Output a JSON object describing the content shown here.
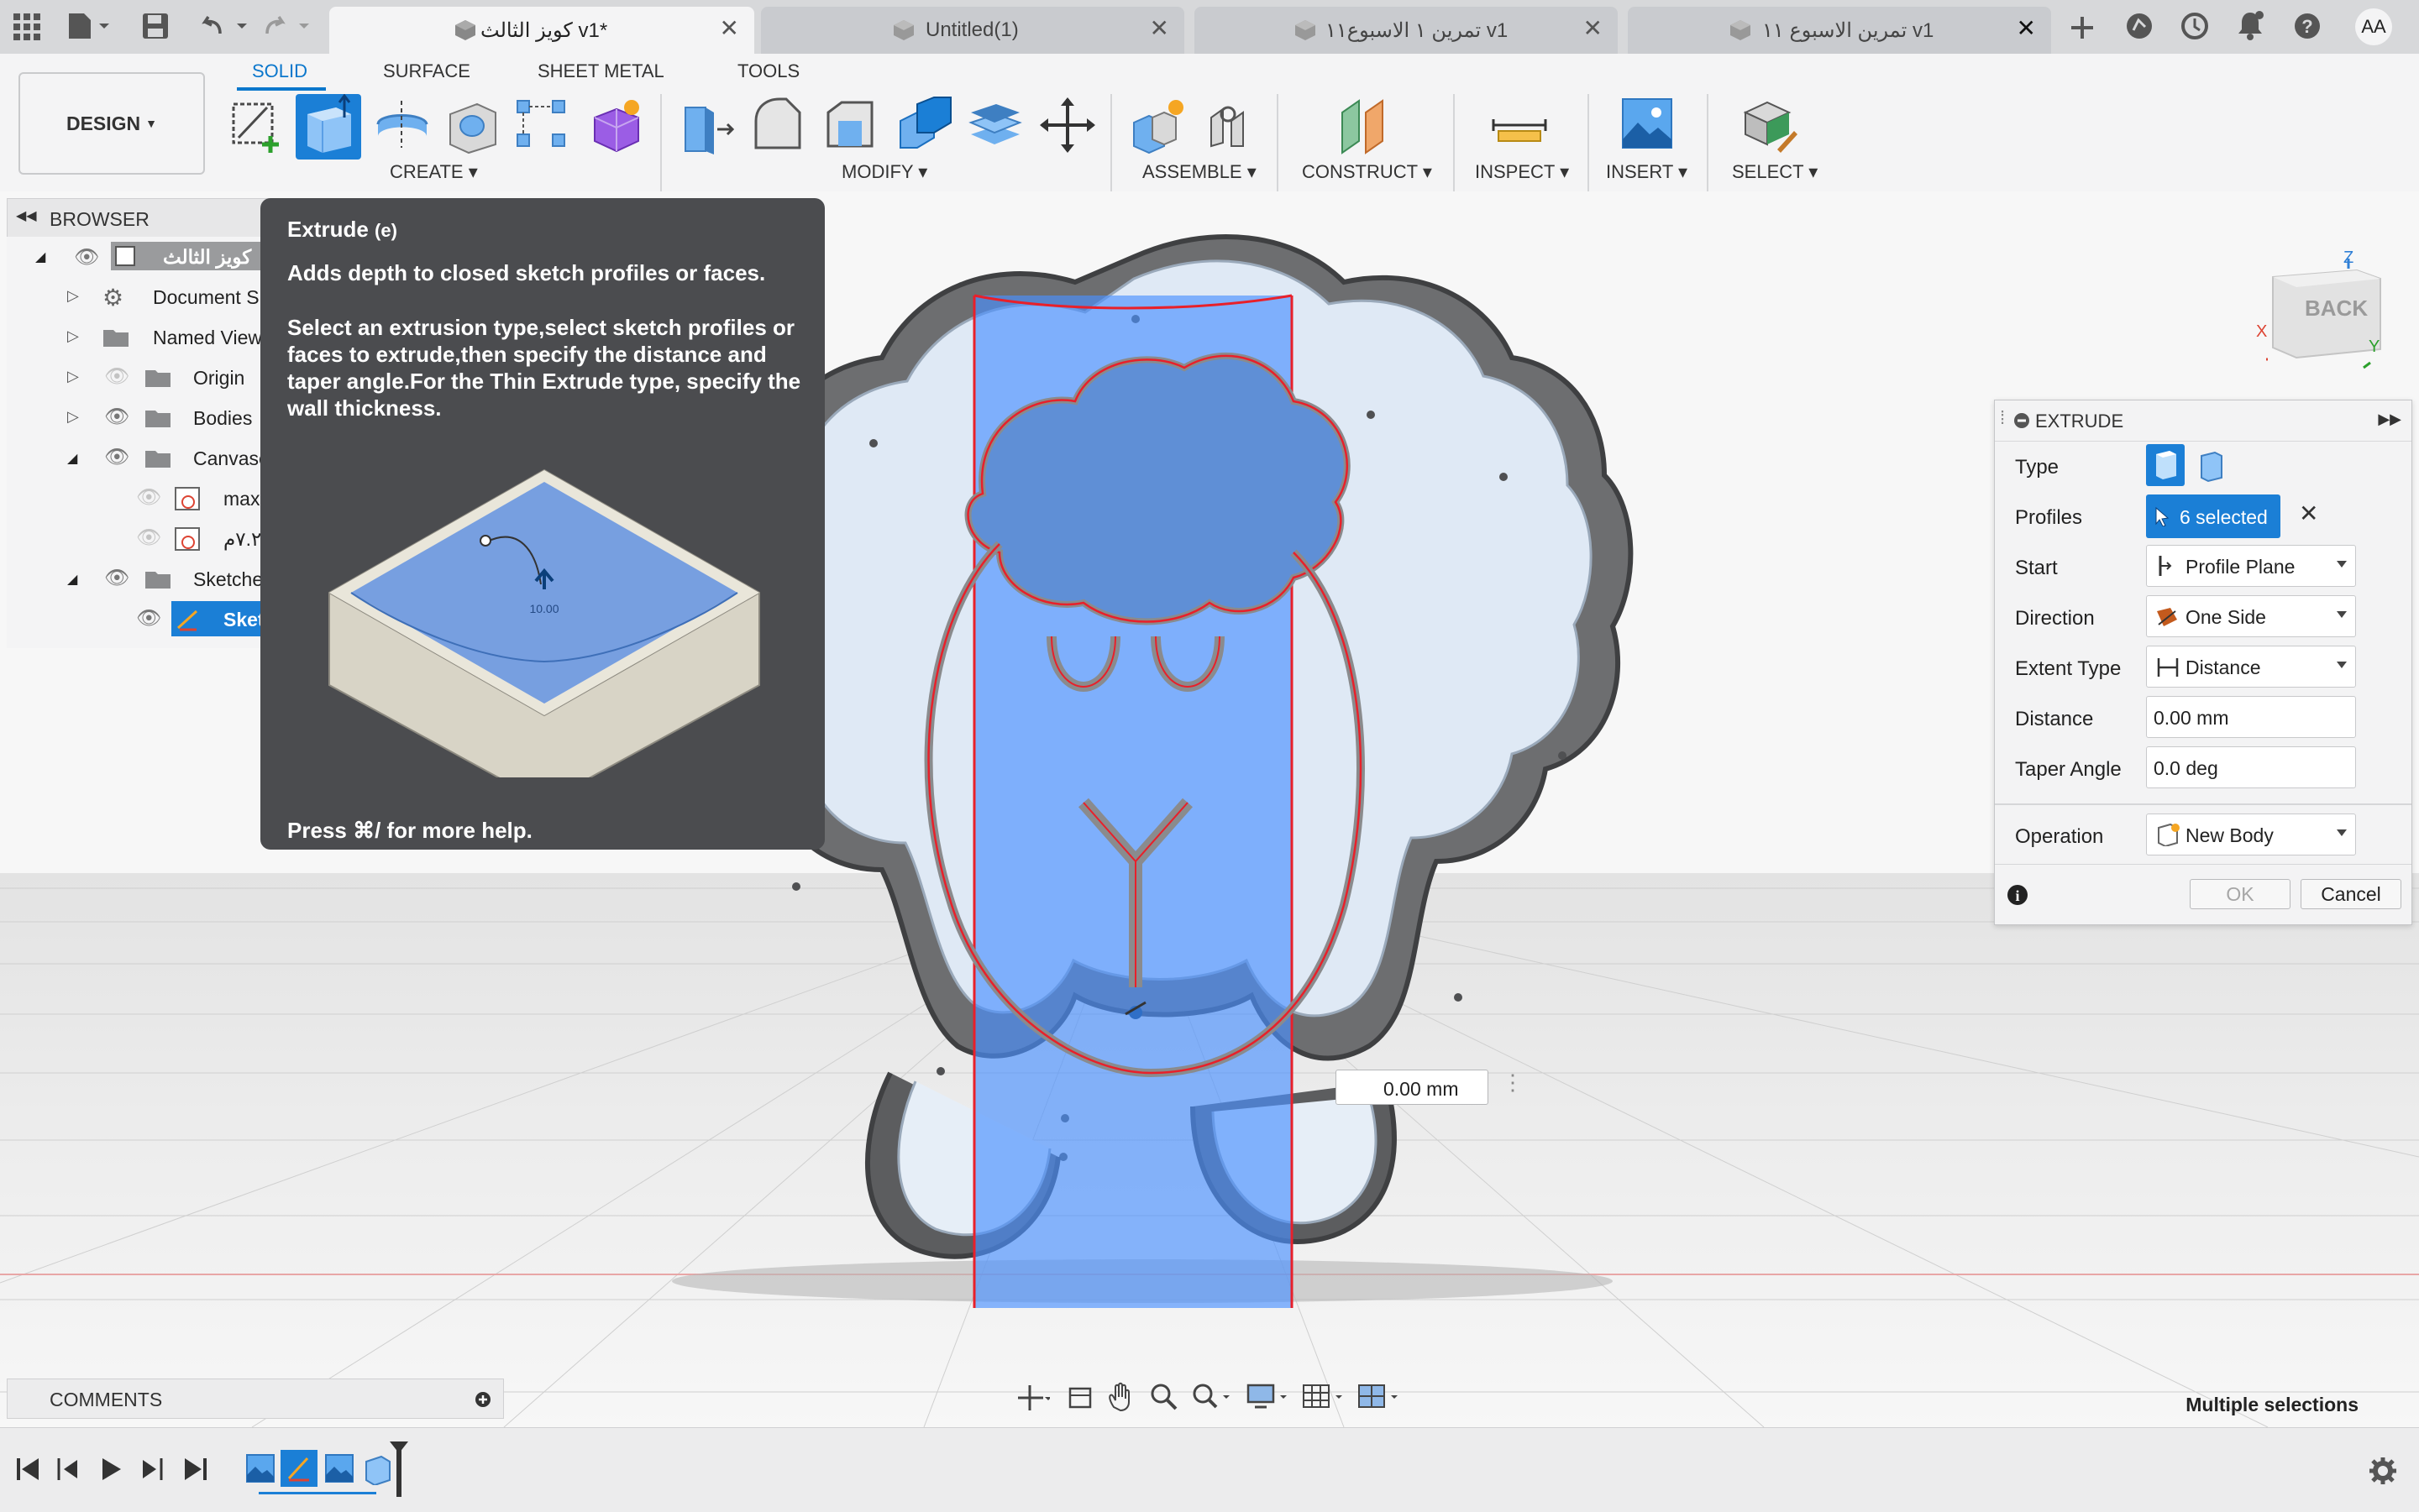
{
  "tabs": [
    {
      "label": "كويز الثالث v1*",
      "active": true
    },
    {
      "label": "Untitled(1)",
      "active": false
    },
    {
      "label": "تمرين ١ الاسبوع١١ v1",
      "active": false
    },
    {
      "label": "تمرين الاسبوع ١١ v1",
      "active": false
    }
  ],
  "user_initials": "AA",
  "workspace": {
    "design_label": "DESIGN",
    "tabs": [
      "SOLID",
      "SURFACE",
      "SHEET METAL",
      "TOOLS"
    ],
    "active_tab": "SOLID"
  },
  "groups": {
    "create": "CREATE",
    "modify": "MODIFY",
    "assemble": "ASSEMBLE",
    "construct": "CONSTRUCT",
    "inspect": "INSPECT",
    "insert": "INSERT",
    "select": "SELECT"
  },
  "browser": {
    "title": "BROWSER",
    "items": [
      {
        "label": "كويز الثالث"
      },
      {
        "label": "Document S"
      },
      {
        "label": "Named View"
      },
      {
        "label": "Origin"
      },
      {
        "label": "Bodies"
      },
      {
        "label": "Canvase"
      },
      {
        "label": "max"
      },
      {
        "label": "٧.٢م"
      },
      {
        "label": "Sketche"
      },
      {
        "label": "Sket"
      }
    ]
  },
  "tooltip": {
    "title": "Extrude",
    "shortcut": "(e)",
    "desc1": "Adds depth to closed sketch profiles or faces.",
    "desc2": "Select an extrusion type,select sketch profiles or faces to extrude,then specify the distance and taper angle.For the Thin Extrude type, specify the wall thickness.",
    "help": "Press ⌘/ for more help.",
    "illustration_value": "10.00"
  },
  "extrude": {
    "title": "EXTRUDE",
    "rows": {
      "type": "Type",
      "profiles": "Profiles",
      "start": "Start",
      "direction": "Direction",
      "extent_type": "Extent Type",
      "distance": "Distance",
      "taper": "Taper Angle",
      "operation": "Operation"
    },
    "profiles_value": "6 selected",
    "start_value": "Profile Plane",
    "direction_value": "One Side",
    "extent_value": "Distance",
    "distance_value": "0.00 mm",
    "taper_value": "0.0 deg",
    "operation_value": "New Body",
    "ok": "OK",
    "cancel": "Cancel"
  },
  "viewcube": {
    "face": "BACK",
    "axis_x": "X",
    "axis_y": "Y",
    "axis_z": "Z"
  },
  "distance_manipulator": "0.00 mm",
  "comments": "COMMENTS",
  "status": "Multiple selections",
  "colors": {
    "accent": "#0b77cc",
    "selection_blue": "#4a90ff",
    "profile_red": "#e8202a"
  }
}
